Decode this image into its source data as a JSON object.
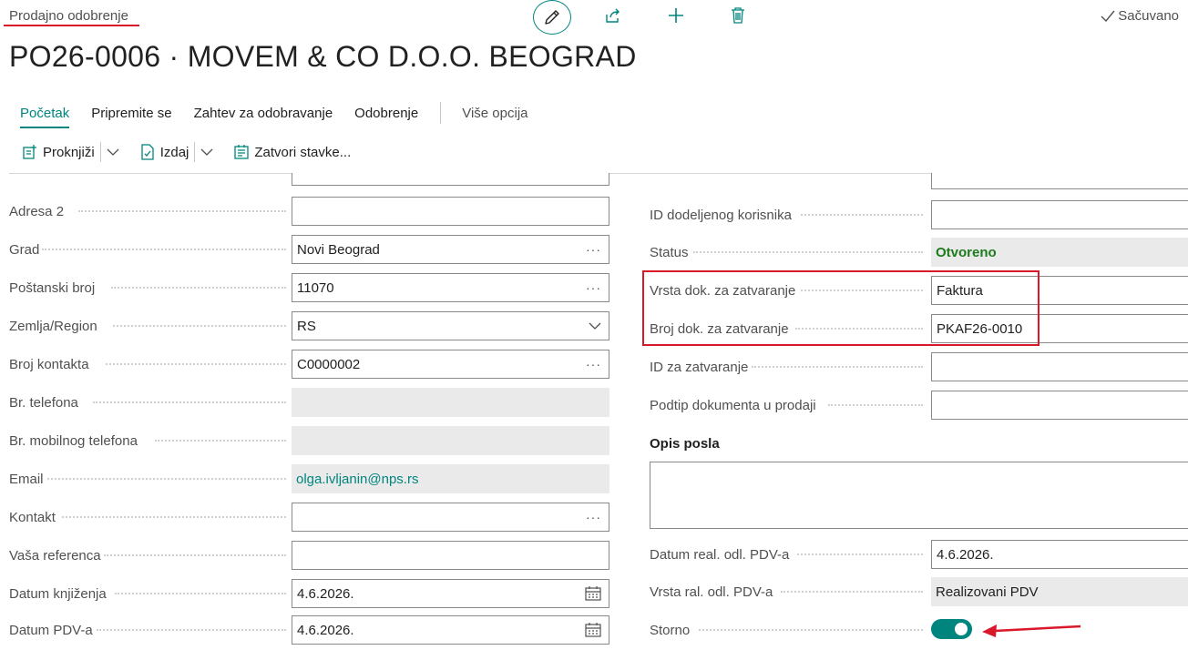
{
  "header": {
    "breadcrumb": "Prodajno odobrenje",
    "saved": "Sačuvano",
    "title": "PO26-0006 · MOVEM & CO D.O.O. BEOGRAD"
  },
  "tabs": [
    {
      "label": "Početak"
    },
    {
      "label": "Pripremite se"
    },
    {
      "label": "Zahtev za odobravanje"
    },
    {
      "label": "Odobrenje"
    },
    {
      "label": "Više opcija"
    }
  ],
  "toolbar": {
    "post": "Proknjiži",
    "issue": "Izdaj",
    "close_lines": "Zatvori stavke..."
  },
  "left": {
    "adresa2": {
      "label": "Adresa 2",
      "value": ""
    },
    "grad": {
      "label": "Grad",
      "value": "Novi Beograd"
    },
    "postanski": {
      "label": "Poštanski broj",
      "value": "11070"
    },
    "zemlja": {
      "label": "Zemlja/Region",
      "value": "RS"
    },
    "broj_kontakta": {
      "label": "Broj kontakta",
      "value": "C0000002"
    },
    "telefon": {
      "label": "Br. telefona",
      "value": ""
    },
    "mobilni": {
      "label": "Br. mobilnog telefona",
      "value": ""
    },
    "email": {
      "label": "Email",
      "value": "olga.ivljanin@nps.rs"
    },
    "kontakt": {
      "label": "Kontakt",
      "value": ""
    },
    "vasa_referenca": {
      "label": "Vaša referenca",
      "value": ""
    },
    "datum_knjizenja": {
      "label": "Datum knjiženja",
      "value": "4.6.2026."
    },
    "datum_pdv": {
      "label": "Datum PDV-a",
      "value": "4.6.2026."
    }
  },
  "right": {
    "id_korisnika": {
      "label": "ID dodeljenog korisnika",
      "value": ""
    },
    "status": {
      "label": "Status",
      "value": "Otvoreno"
    },
    "vrsta_dok": {
      "label": "Vrsta dok. za zatvaranje",
      "value": "Faktura"
    },
    "broj_dok": {
      "label": "Broj dok. za zatvaranje",
      "value": "PKAF26-0010"
    },
    "id_zatvaranje": {
      "label": "ID za zatvaranje",
      "value": ""
    },
    "podtip": {
      "label": "Podtip dokumenta u prodaji",
      "value": ""
    },
    "opis_posla": {
      "label": "Opis posla"
    },
    "datum_real": {
      "label": "Datum real. odl. PDV-a",
      "value": "4.6.2026."
    },
    "vrsta_ral": {
      "label": "Vrsta ral. odl. PDV-a",
      "value": "Realizovani PDV"
    },
    "storno": {
      "label": "Storno",
      "value": true
    }
  },
  "icons": {
    "edit": "pencil-icon",
    "share": "share-icon",
    "new": "plus-icon",
    "delete": "trash-icon",
    "saved": "check-icon"
  },
  "colors": {
    "accent": "#00857e",
    "highlight": "#d9182a",
    "status_open": "#1e7a1e"
  }
}
